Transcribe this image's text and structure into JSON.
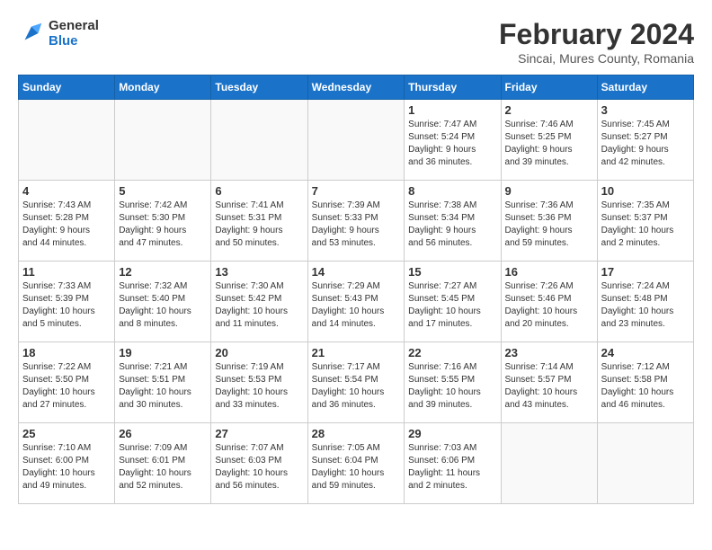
{
  "logo": {
    "line1": "General",
    "line2": "Blue"
  },
  "header": {
    "month": "February 2024",
    "location": "Sincai, Mures County, Romania"
  },
  "weekdays": [
    "Sunday",
    "Monday",
    "Tuesday",
    "Wednesday",
    "Thursday",
    "Friday",
    "Saturday"
  ],
  "weeks": [
    [
      {
        "day": "",
        "info": ""
      },
      {
        "day": "",
        "info": ""
      },
      {
        "day": "",
        "info": ""
      },
      {
        "day": "",
        "info": ""
      },
      {
        "day": "1",
        "info": "Sunrise: 7:47 AM\nSunset: 5:24 PM\nDaylight: 9 hours\nand 36 minutes."
      },
      {
        "day": "2",
        "info": "Sunrise: 7:46 AM\nSunset: 5:25 PM\nDaylight: 9 hours\nand 39 minutes."
      },
      {
        "day": "3",
        "info": "Sunrise: 7:45 AM\nSunset: 5:27 PM\nDaylight: 9 hours\nand 42 minutes."
      }
    ],
    [
      {
        "day": "4",
        "info": "Sunrise: 7:43 AM\nSunset: 5:28 PM\nDaylight: 9 hours\nand 44 minutes."
      },
      {
        "day": "5",
        "info": "Sunrise: 7:42 AM\nSunset: 5:30 PM\nDaylight: 9 hours\nand 47 minutes."
      },
      {
        "day": "6",
        "info": "Sunrise: 7:41 AM\nSunset: 5:31 PM\nDaylight: 9 hours\nand 50 minutes."
      },
      {
        "day": "7",
        "info": "Sunrise: 7:39 AM\nSunset: 5:33 PM\nDaylight: 9 hours\nand 53 minutes."
      },
      {
        "day": "8",
        "info": "Sunrise: 7:38 AM\nSunset: 5:34 PM\nDaylight: 9 hours\nand 56 minutes."
      },
      {
        "day": "9",
        "info": "Sunrise: 7:36 AM\nSunset: 5:36 PM\nDaylight: 9 hours\nand 59 minutes."
      },
      {
        "day": "10",
        "info": "Sunrise: 7:35 AM\nSunset: 5:37 PM\nDaylight: 10 hours\nand 2 minutes."
      }
    ],
    [
      {
        "day": "11",
        "info": "Sunrise: 7:33 AM\nSunset: 5:39 PM\nDaylight: 10 hours\nand 5 minutes."
      },
      {
        "day": "12",
        "info": "Sunrise: 7:32 AM\nSunset: 5:40 PM\nDaylight: 10 hours\nand 8 minutes."
      },
      {
        "day": "13",
        "info": "Sunrise: 7:30 AM\nSunset: 5:42 PM\nDaylight: 10 hours\nand 11 minutes."
      },
      {
        "day": "14",
        "info": "Sunrise: 7:29 AM\nSunset: 5:43 PM\nDaylight: 10 hours\nand 14 minutes."
      },
      {
        "day": "15",
        "info": "Sunrise: 7:27 AM\nSunset: 5:45 PM\nDaylight: 10 hours\nand 17 minutes."
      },
      {
        "day": "16",
        "info": "Sunrise: 7:26 AM\nSunset: 5:46 PM\nDaylight: 10 hours\nand 20 minutes."
      },
      {
        "day": "17",
        "info": "Sunrise: 7:24 AM\nSunset: 5:48 PM\nDaylight: 10 hours\nand 23 minutes."
      }
    ],
    [
      {
        "day": "18",
        "info": "Sunrise: 7:22 AM\nSunset: 5:50 PM\nDaylight: 10 hours\nand 27 minutes."
      },
      {
        "day": "19",
        "info": "Sunrise: 7:21 AM\nSunset: 5:51 PM\nDaylight: 10 hours\nand 30 minutes."
      },
      {
        "day": "20",
        "info": "Sunrise: 7:19 AM\nSunset: 5:53 PM\nDaylight: 10 hours\nand 33 minutes."
      },
      {
        "day": "21",
        "info": "Sunrise: 7:17 AM\nSunset: 5:54 PM\nDaylight: 10 hours\nand 36 minutes."
      },
      {
        "day": "22",
        "info": "Sunrise: 7:16 AM\nSunset: 5:55 PM\nDaylight: 10 hours\nand 39 minutes."
      },
      {
        "day": "23",
        "info": "Sunrise: 7:14 AM\nSunset: 5:57 PM\nDaylight: 10 hours\nand 43 minutes."
      },
      {
        "day": "24",
        "info": "Sunrise: 7:12 AM\nSunset: 5:58 PM\nDaylight: 10 hours\nand 46 minutes."
      }
    ],
    [
      {
        "day": "25",
        "info": "Sunrise: 7:10 AM\nSunset: 6:00 PM\nDaylight: 10 hours\nand 49 minutes."
      },
      {
        "day": "26",
        "info": "Sunrise: 7:09 AM\nSunset: 6:01 PM\nDaylight: 10 hours\nand 52 minutes."
      },
      {
        "day": "27",
        "info": "Sunrise: 7:07 AM\nSunset: 6:03 PM\nDaylight: 10 hours\nand 56 minutes."
      },
      {
        "day": "28",
        "info": "Sunrise: 7:05 AM\nSunset: 6:04 PM\nDaylight: 10 hours\nand 59 minutes."
      },
      {
        "day": "29",
        "info": "Sunrise: 7:03 AM\nSunset: 6:06 PM\nDaylight: 11 hours\nand 2 minutes."
      },
      {
        "day": "",
        "info": ""
      },
      {
        "day": "",
        "info": ""
      }
    ]
  ]
}
